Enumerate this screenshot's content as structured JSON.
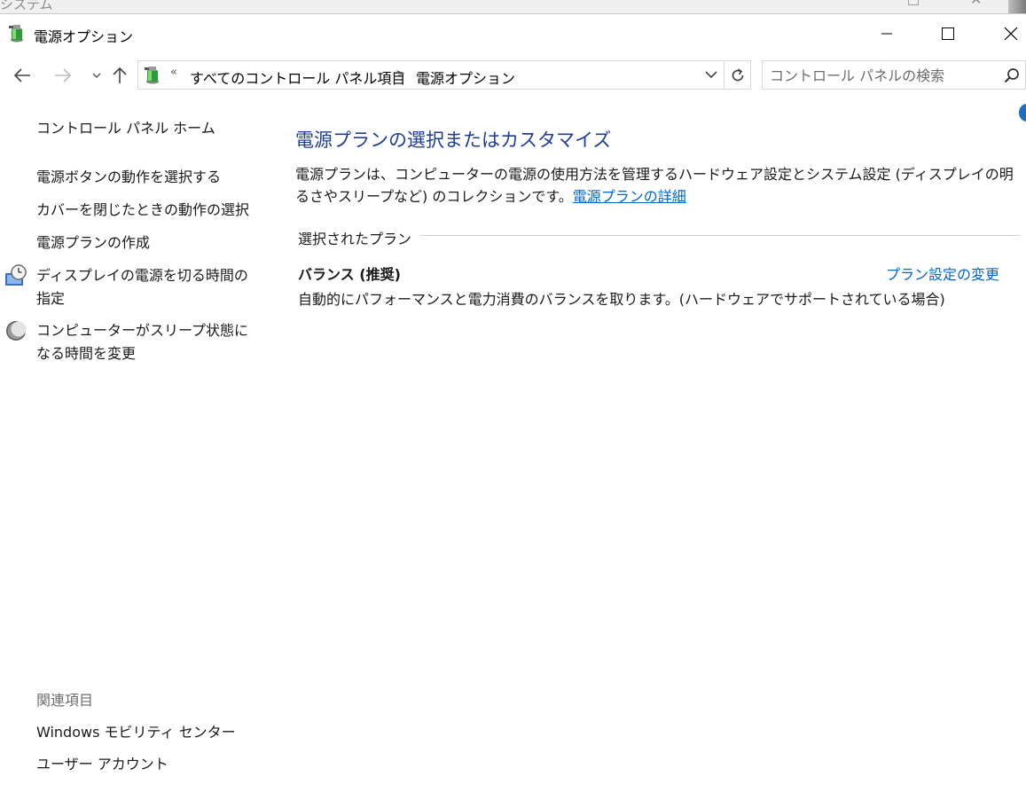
{
  "background_window": {
    "title": "システム"
  },
  "window": {
    "title": "電源オプション"
  },
  "nav": {
    "breadcrumb_overflow": "«",
    "breadcrumbs": [
      "すべてのコントロール パネル項目",
      "電源オプション"
    ],
    "separator": ">",
    "search_placeholder": "コントロール パネルの検索"
  },
  "sidebar": {
    "home": "コントロール パネル ホーム",
    "tasks": [
      "電源ボタンの動作を選択する",
      "カバーを閉じたときの動作の選択",
      "電源プランの作成",
      "ディスプレイの電源を切る時間の指定",
      "コンピューターがスリープ状態になる時間を変更"
    ],
    "see_also_heading": "関連項目",
    "see_also": [
      "Windows モビリティ センター",
      "ユーザー アカウント"
    ]
  },
  "main": {
    "title": "電源プランの選択またはカスタマイズ",
    "description": "電源プランは、コンピューターの電源の使用方法を管理するハードウェア設定とシステム設定 (ディスプレイの明るさやスリープなど) のコレクションです。",
    "description_link": "電源プランの詳細",
    "selected_plan_label": "選択されたプラン",
    "plan": {
      "name": "バランス (推奨)",
      "change_link": "プラン設定の変更",
      "description": "自動的にパフォーマンスと電力消費のバランスを取ります。(ハードウェアでサポートされている場合)"
    }
  },
  "colors": {
    "title_blue": "#1e3f94",
    "link_blue": "#0066cc",
    "muted_text": "#6d6d6d"
  },
  "icons": {
    "app": "power-options-icon",
    "display_timer": "clock-monitor-icon",
    "sleep": "moon-sleep-icon"
  }
}
